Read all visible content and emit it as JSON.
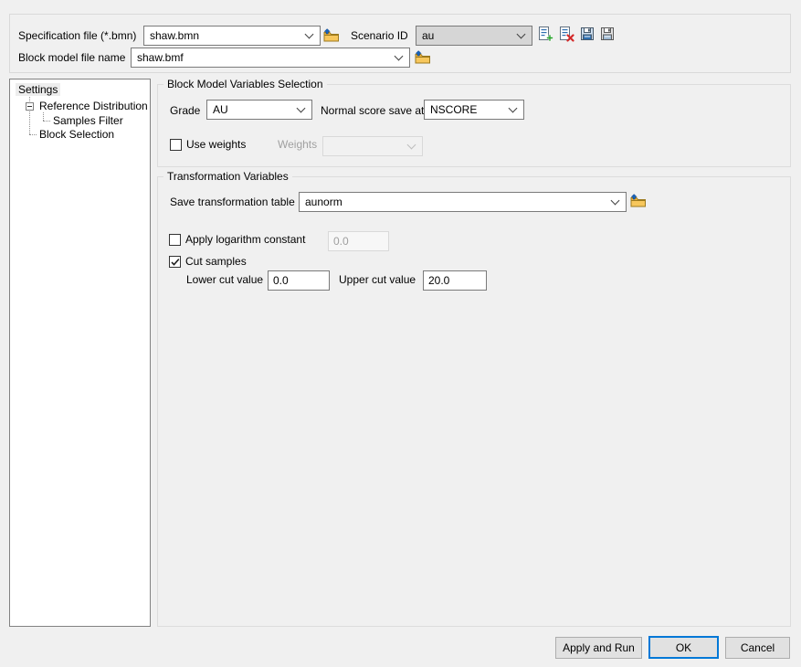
{
  "colors": {
    "window_bg": "#f0f0f0",
    "accent": "#0078d7",
    "group_border": "#dcdcdc",
    "control_border": "#7a7a7a",
    "button_bg": "#e1e1e1",
    "folder_icon_yellow": "#f2b53c",
    "add_icon_green": "#23a127",
    "delete_icon_red": "#d42a2a",
    "doc_line_blue": "#2e6fb0"
  },
  "top": {
    "spec_label": "Specification file (*.bmn)",
    "spec_value": "shaw.bmn",
    "scenario_label": "Scenario ID",
    "scenario_value": "au",
    "block_label": "Block model file name",
    "block_value": "shaw.bmf",
    "icons": [
      "browse-folder-icon",
      "add-scenario-icon",
      "delete-scenario-icon",
      "save-scenario-icon",
      "save-scenario-as-icon"
    ]
  },
  "tree": {
    "items": [
      {
        "label": "Settings",
        "selected": true
      },
      {
        "label": "Reference Distribution",
        "expanded": true
      },
      {
        "label": "Samples Filter"
      },
      {
        "label": "Block Selection"
      }
    ]
  },
  "group_variables": {
    "title": "Block Model Variables Selection",
    "grade_label": "Grade",
    "grade_value": "AU",
    "nscore_label": "Normal score save at",
    "nscore_value": "NSCORE",
    "use_weights_label": "Use weights",
    "use_weights_checked": false,
    "weights_label": "Weights",
    "weights_value": ""
  },
  "group_transform": {
    "title": "Transformation Variables",
    "save_table_label": "Save transformation table",
    "save_table_value": "aunorm",
    "log_label": "Apply logarithm constant",
    "log_checked": false,
    "log_value": "0.0",
    "cut_label": "Cut samples",
    "cut_checked": true,
    "lower_label": "Lower cut value",
    "lower_value": "0.0",
    "upper_label": "Upper cut value",
    "upper_value": "20.0"
  },
  "buttons": {
    "apply_run": "Apply and Run",
    "ok": "OK",
    "cancel": "Cancel"
  }
}
